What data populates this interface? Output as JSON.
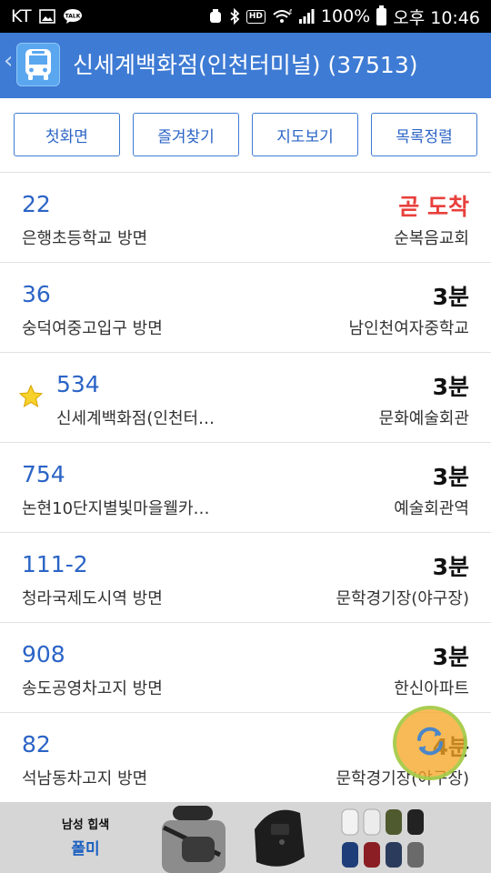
{
  "status_bar": {
    "carrier": "KT",
    "battery": "100%",
    "time": "오후 10:46",
    "notif_badge": "TALK",
    "hd_badge": "HD",
    "wifi_badge": "6"
  },
  "header": {
    "title": "신세계백화점(인천터미널) (37513)",
    "back_glyph": "‹"
  },
  "buttons": {
    "home": "첫화면",
    "favorites": "즐겨찾기",
    "map": "지도보기",
    "sort": "목록정렬"
  },
  "routes": [
    {
      "number": "22",
      "direction": "은행초등학교 방면",
      "eta": "곧 도착",
      "stop": "순복음교회"
    },
    {
      "number": "36",
      "direction": "숭덕여중고입구 방면",
      "eta": "3분",
      "stop": "남인천여자중학교"
    },
    {
      "number": "534",
      "direction": "신세계백화점(인천터…",
      "eta": "3분",
      "stop": "문화예술회관"
    },
    {
      "number": "754",
      "direction": "논현10단지별빛마을웰카…",
      "eta": "3분",
      "stop": "예술회관역"
    },
    {
      "number": "111-2",
      "direction": "청라국제도시역 방면",
      "eta": "3분",
      "stop": "문학경기장(야구장)"
    },
    {
      "number": "908",
      "direction": "송도공영차고지 방면",
      "eta": "3분",
      "stop": "한신아파트"
    },
    {
      "number": "82",
      "direction": "석남동차고지 방면",
      "eta": "4분",
      "stop": "문학경기장(야구장)"
    }
  ],
  "ad": {
    "brand_top": "남성 힙색",
    "brand_name": "폴미"
  },
  "colors": {
    "header_bg": "#3e7bd4",
    "accent_blue": "#2b64c6",
    "arriving_red": "#e8403c",
    "fab_orange": "#f6a628"
  },
  "icons": [
    "bus-icon",
    "star-icon",
    "refresh-icon",
    "back-icon"
  ]
}
